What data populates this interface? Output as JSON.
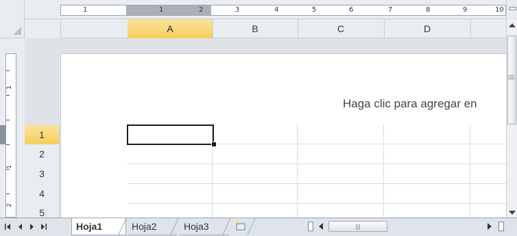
{
  "colors": {
    "selected_header": "#f6cf5a",
    "header_bg": "#e9edf2",
    "grid_line": "#d8dce1",
    "page_bg": "#dfe3e8"
  },
  "ruler": {
    "horizontal_numbers": [
      "1",
      "1",
      "2",
      "3",
      "4",
      "5",
      "6",
      "7",
      "8",
      "9",
      "10"
    ],
    "vertical_numbers": [
      "1",
      "1",
      "2"
    ]
  },
  "columns": [
    "A",
    "B",
    "C",
    "D"
  ],
  "selected_column": "A",
  "rows": [
    "1",
    "2",
    "3",
    "4",
    "5"
  ],
  "selected_row": "1",
  "page": {
    "header_hint": "Haga clic para agregar en"
  },
  "active_cell": "A1",
  "sheets": {
    "nav_icons": [
      "first-sheet-icon",
      "prev-sheet-icon",
      "next-sheet-icon",
      "last-sheet-icon"
    ],
    "tabs": [
      {
        "label": "Hoja1",
        "active": true
      },
      {
        "label": "Hoja2",
        "active": false
      },
      {
        "label": "Hoja3",
        "active": false
      }
    ],
    "new_sheet_icon": "insert-sheet-icon"
  },
  "scrollbar": {
    "grip_glyph": "|||"
  }
}
